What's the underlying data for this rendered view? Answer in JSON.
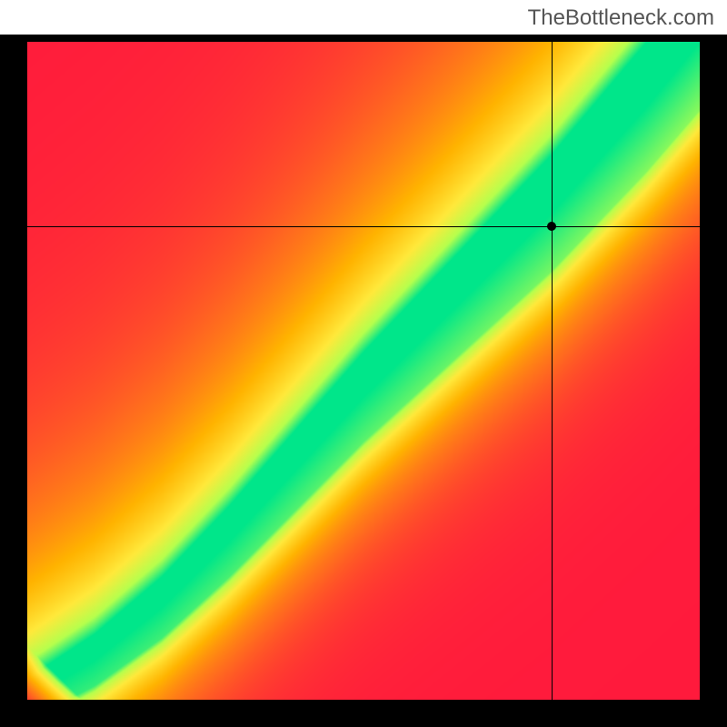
{
  "watermark": "TheBottleneck.com",
  "chart_data": {
    "type": "heatmap",
    "title": "",
    "xlabel": "",
    "ylabel": "",
    "xlim": [
      0,
      100
    ],
    "ylim": [
      0,
      100
    ],
    "crosshair": {
      "x": 78,
      "y": 72
    },
    "ridge": {
      "description": "Optimal (green) band along a super-linear curve from bottom-left to top-right; values falling away to yellow→orange→red on either side.",
      "curve_points": [
        {
          "x": 0,
          "y": 0
        },
        {
          "x": 10,
          "y": 6
        },
        {
          "x": 20,
          "y": 14
        },
        {
          "x": 30,
          "y": 24
        },
        {
          "x": 40,
          "y": 35
        },
        {
          "x": 50,
          "y": 46
        },
        {
          "x": 60,
          "y": 56
        },
        {
          "x": 70,
          "y": 66
        },
        {
          "x": 78,
          "y": 74
        },
        {
          "x": 85,
          "y": 82
        },
        {
          "x": 92,
          "y": 90
        },
        {
          "x": 100,
          "y": 100
        }
      ],
      "band_width": 8
    },
    "colorscale": [
      {
        "t": 0.0,
        "hex": "#ff1a3c"
      },
      {
        "t": 0.25,
        "hex": "#ff6a1f"
      },
      {
        "t": 0.5,
        "hex": "#ffb300"
      },
      {
        "t": 0.72,
        "hex": "#ffe93b"
      },
      {
        "t": 0.88,
        "hex": "#b6ff4d"
      },
      {
        "t": 1.0,
        "hex": "#00e68a"
      }
    ],
    "corner_colors": {
      "bottom_left": "#ff1a3c",
      "bottom_right": "#ff1a3c",
      "top_left": "#ff1a3c",
      "top_right": "#ffe93b"
    }
  }
}
